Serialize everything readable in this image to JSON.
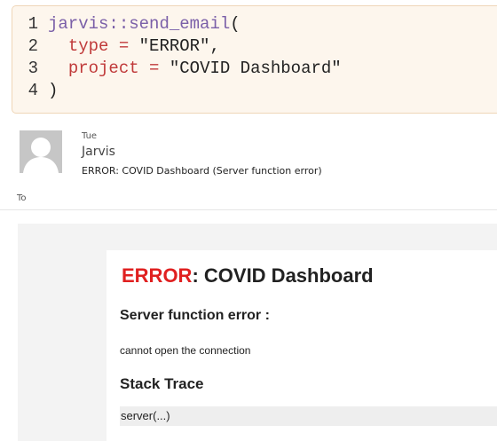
{
  "code": {
    "lines": [
      {
        "no": "1",
        "ns": "jarvis",
        "sep": "::",
        "fn": "send_email",
        "paren": "("
      },
      {
        "no": "2",
        "arg": "type",
        "op": " = ",
        "val": "\"ERROR\"",
        "comma": ","
      },
      {
        "no": "3",
        "arg": "project",
        "op": " = ",
        "val": "\"COVID Dashboard\""
      },
      {
        "no": "4",
        "close": ")"
      }
    ]
  },
  "email": {
    "day": "Tue",
    "from": "Jarvis",
    "subject": "ERROR: COVID Dashboard (Server function error)",
    "to_label": "To"
  },
  "message": {
    "title_error": "ERROR",
    "title_rest": ": COVID Dashboard",
    "server_heading": "Server function error :",
    "server_message": "cannot open the connection",
    "stack_heading": "Stack Trace",
    "stack_line": "server(...)"
  },
  "colors": {
    "error_red": "#e02020",
    "code_bg": "#fdf6ed"
  }
}
